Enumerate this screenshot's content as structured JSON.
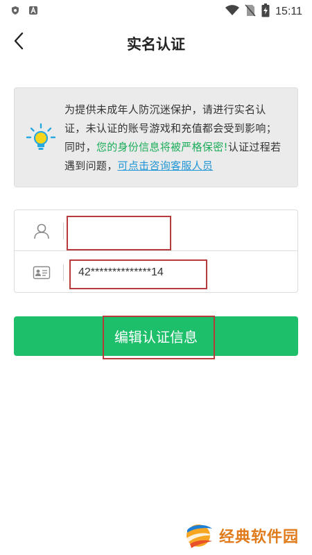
{
  "status_bar": {
    "time": "15:11",
    "left_icons": [
      "shield-icon",
      "app-a-icon"
    ],
    "right_icons": [
      "wifi-icon",
      "no-sim-icon",
      "battery-charging-icon"
    ]
  },
  "header": {
    "title": "实名认证",
    "back_icon": "chevron-left-icon"
  },
  "notice": {
    "icon": "lightbulb-icon",
    "text_part1": "为提供未成年人防沉迷保护，请进行实名认证，未认证的账号游戏和充值都会受到影响；同时，",
    "text_highlight": "您的身份信息将被严格保密!",
    "text_part2": "认证过程若遇到问题，",
    "link_text": "可点击咨询客服人员"
  },
  "form": {
    "name_field": {
      "icon": "user-icon",
      "value": ""
    },
    "id_field": {
      "icon": "id-card-icon",
      "value": "42**************14"
    }
  },
  "button": {
    "label": "编辑认证信息"
  },
  "watermark": {
    "text": "经典软件园"
  },
  "colors": {
    "primary_green": "#1dbf6b",
    "highlight_green": "#1aad5a",
    "link_blue": "#2196d6",
    "annotation_red": "#b83b3b",
    "watermark_orange": "#e07b1c",
    "notice_bg": "#ebebeb"
  }
}
